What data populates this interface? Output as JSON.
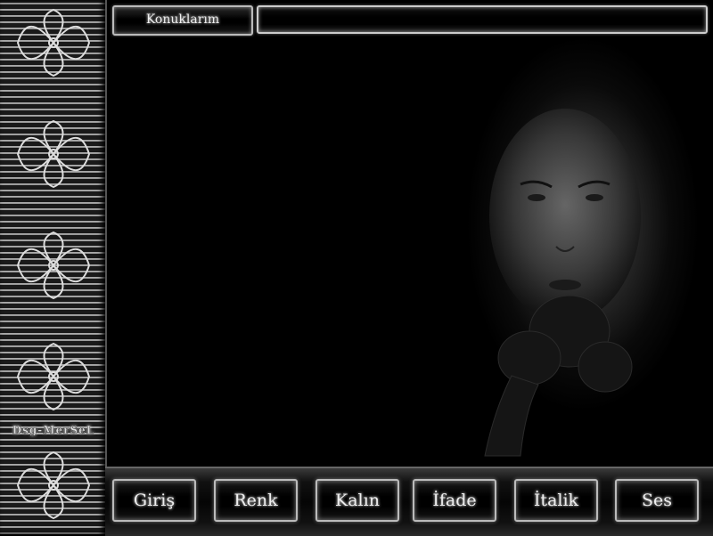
{
  "header": {
    "tab_label": "Konuklarım"
  },
  "sidebar": {
    "signature": "Dsg-MerSeL",
    "ornament_icon": "celtic-knot-ornament-icon"
  },
  "nav": {
    "buttons": [
      {
        "label": "Giriş"
      },
      {
        "label": "Renk"
      },
      {
        "label": "Kalın"
      },
      {
        "label": "İfade"
      },
      {
        "label": "İtalik"
      },
      {
        "label": "Ses"
      }
    ]
  },
  "colors": {
    "background": "#000000",
    "border_silver": "#bbbbbb",
    "text": "#eeeeee"
  }
}
